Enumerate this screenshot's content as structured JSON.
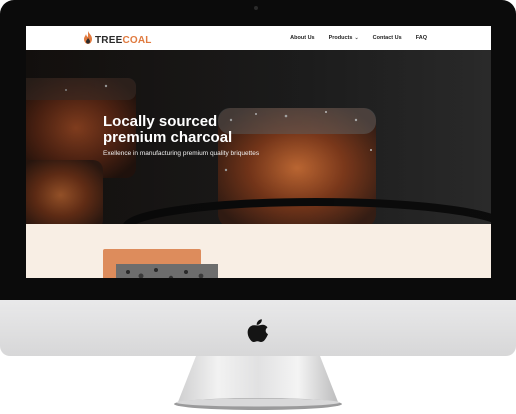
{
  "site": {
    "logo_text_1": "TREE",
    "logo_text_2": "COAL",
    "nav": {
      "about": "About Us",
      "products": "Products",
      "contact": "Contact Us",
      "faq": "FAQ"
    },
    "hero": {
      "title_line_1": "Locally sourced",
      "title_line_2": "premium charcoal",
      "subtitle": "Exellence in manufacturing premium quality briquettes"
    }
  },
  "colors": {
    "accent": "#e07a3f",
    "section_bg": "#f8eee4",
    "nav_bg": "#ffffff"
  },
  "icons": {
    "logo": "flame-icon",
    "apple": "apple-logo-icon",
    "dropdown": "chevron-down-icon"
  }
}
